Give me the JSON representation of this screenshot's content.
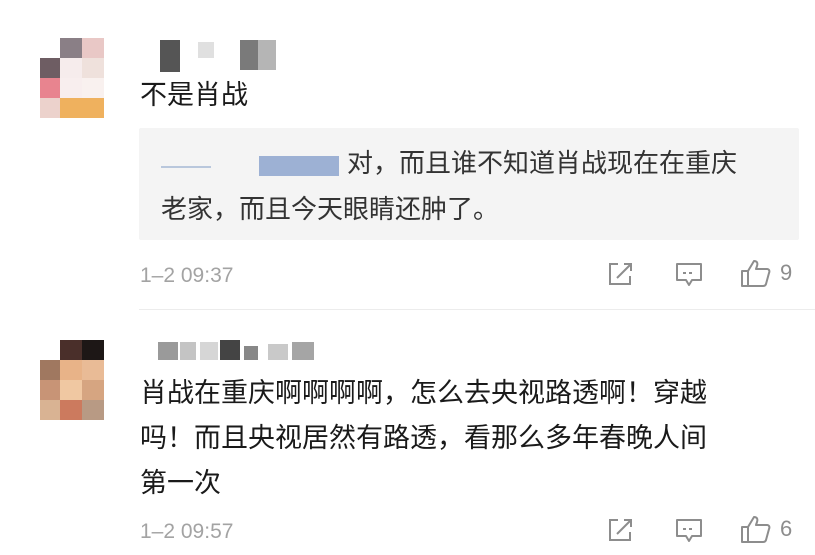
{
  "comments": [
    {
      "text": "不是肖战",
      "reply": {
        "text_line1": "对，而且谁不知道肖战现在在重庆",
        "text_line2": "老家，而且今天眼睛还肿了。"
      },
      "time": "1–2 09:37",
      "likes": "9"
    },
    {
      "text_lines": [
        "肖战在重庆啊啊啊啊，怎么去央视路透啊！穿越",
        "吗！而且央视居然有路透，看那么多年春晚人间",
        "第一次"
      ],
      "time": "1–2 09:57",
      "likes": "6"
    }
  ],
  "icons": {
    "forward": "forward-icon",
    "comment": "comment-icon",
    "like": "thumbs-up-icon"
  },
  "colors": {
    "meta_gray": "#a3a3a3",
    "quote_bg": "#f4f4f4",
    "icon_gray": "#8d8d8d"
  }
}
